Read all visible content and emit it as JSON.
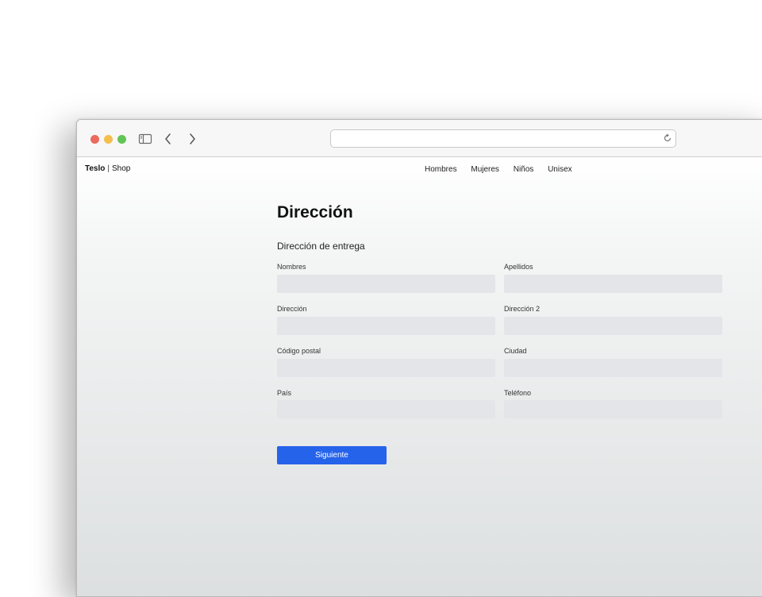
{
  "browser": {
    "address_value": "",
    "icons": [
      "close-dot",
      "minimize-dot",
      "zoom-dot",
      "sidebar-icon",
      "back-chevron-icon",
      "forward-chevron-icon",
      "reload-icon"
    ]
  },
  "header": {
    "brand": "Teslo",
    "separator": "|",
    "brand_suffix": "Shop",
    "nav": [
      "Hombres",
      "Mujeres",
      "Niños",
      "Unisex"
    ]
  },
  "main": {
    "title": "Dirección",
    "section_title": "Dirección de entrega",
    "fields": [
      {
        "label": "Nombres",
        "value": ""
      },
      {
        "label": "Apellidos",
        "value": ""
      },
      {
        "label": "Dirección",
        "value": ""
      },
      {
        "label": "Dirección 2",
        "value": ""
      },
      {
        "label": "Código postal",
        "value": ""
      },
      {
        "label": "Ciudad",
        "value": ""
      },
      {
        "label": "País",
        "value": ""
      },
      {
        "label": "Teléfono",
        "value": ""
      }
    ],
    "submit_label": "Siguiente"
  },
  "colors": {
    "primary_button": "#2563eb",
    "input_background": "#e4e5e8",
    "traffic_red": "#ec6a5e",
    "traffic_yellow": "#f4bf4f",
    "traffic_green": "#61c554"
  }
}
